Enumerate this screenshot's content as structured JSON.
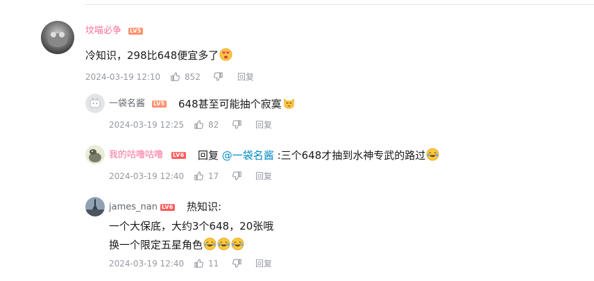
{
  "comments": [
    {
      "username": "坟喵必争",
      "username_color": "#fb7299",
      "level": "LV5",
      "text": "冷知识，298比648便宜多了",
      "time": "2024-03-19 12:10",
      "likes": "852",
      "reply_label": "回复"
    }
  ],
  "replies": [
    {
      "username": "一袋名酱",
      "level": "LV5",
      "text": "648甚至可能抽个寂寞",
      "time": "2024-03-19 12:25",
      "likes": "82",
      "reply_label": "回复"
    },
    {
      "username": "我的咕噜咕噜",
      "username_color": "#fb7299",
      "level": "LV6",
      "reply_prefix": "回复 ",
      "mention": "@一袋名酱",
      "text": " :三个648才抽到水神专武的路过",
      "time": "2024-03-19 12:40",
      "likes": "17",
      "reply_label": "回复"
    },
    {
      "username": "james_nan",
      "level": "LV6",
      "lines": [
        "热知识:",
        "一个大保底，大约3个648，20张哦",
        "换一个限定五星角色"
      ],
      "time": "2024-03-19 12:40",
      "likes": "11",
      "reply_label": "回复"
    }
  ],
  "colors": {
    "meta": "#9499a0",
    "mention": "#008ac5",
    "lv5": "#ff8f6b",
    "lv6": "#ff5c5c"
  },
  "icons": [
    "thumb-up-icon",
    "thumb-down-icon",
    "emoji-heart-eyes",
    "emoji-smirk-cat",
    "emoji-laughing-tears"
  ]
}
